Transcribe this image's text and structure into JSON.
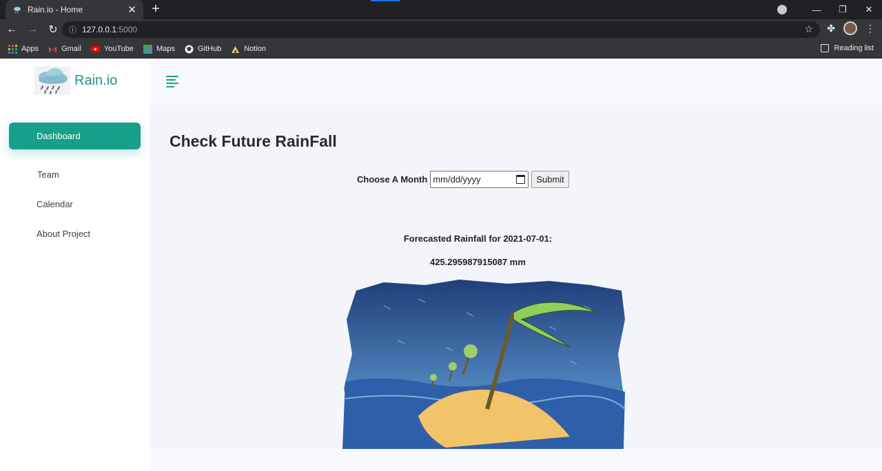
{
  "browser": {
    "tab_title": "Rain.io - Home",
    "url_host": "127.0.0.1",
    "url_port": ":5000",
    "bookmarks": [
      {
        "label": "Apps",
        "icon": "apps-grid-icon",
        "color": "#ea4335"
      },
      {
        "label": "Gmail",
        "icon": "gmail-icon",
        "color": "#ea4335"
      },
      {
        "label": "YouTube",
        "icon": "youtube-icon",
        "color": "#ff0000"
      },
      {
        "label": "Maps",
        "icon": "maps-icon",
        "color": "#34a853"
      },
      {
        "label": "GitHub",
        "icon": "github-icon",
        "color": "#e8eaed"
      },
      {
        "label": "Notion",
        "icon": "notion-icon",
        "color": "#e0c97a"
      }
    ],
    "reading_list": "Reading list"
  },
  "sidebar": {
    "brand": "Rain.io",
    "items": [
      {
        "label": "Dashboard",
        "active": true
      },
      {
        "label": "Team",
        "active": false
      },
      {
        "label": "Calendar",
        "active": false
      },
      {
        "label": "About Project",
        "active": false
      }
    ]
  },
  "main": {
    "title": "Check Future RainFall",
    "form": {
      "label": "Choose A Month",
      "date_placeholder": "mm/dd/yyyy",
      "submit_label": "Submit"
    },
    "forecast_label": "Forecasted Rainfall for 2021-07-01:",
    "forecast_value": "425.295987915087 mm"
  },
  "colors": {
    "accent": "#16a08b",
    "brand": "#1a9686"
  }
}
